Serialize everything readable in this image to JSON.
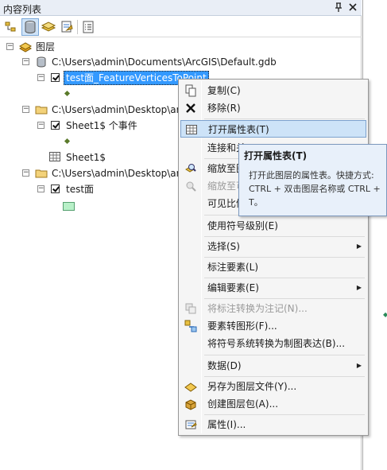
{
  "panel": {
    "title": "内容列表",
    "pin_glyph": "ᵖ",
    "close_glyph": "×"
  },
  "toolbar": {
    "buttons": [
      {
        "icon": "list-by-drawing-order-icon",
        "active": false
      },
      {
        "icon": "list-by-source-icon",
        "active": true
      },
      {
        "icon": "list-by-visibility-icon",
        "active": false
      },
      {
        "icon": "list-by-selection-icon",
        "active": false
      },
      {
        "icon": "options-icon",
        "active": false
      }
    ]
  },
  "tree": {
    "root": "图层",
    "groups": [
      {
        "path": "C:\\Users\\admin\\Documents\\ArcGIS\\Default.gdb",
        "layer": "test面_FeatureVerticesToPoint"
      },
      {
        "path": "C:\\Users\\admin\\Desktop\\ar",
        "layer": "Sheet1$ 个事件",
        "table": "Sheet1$"
      },
      {
        "path": "C:\\Users\\admin\\Desktop\\ar",
        "layer": "test面"
      }
    ]
  },
  "menu": {
    "items": [
      {
        "label": "复制(C)",
        "icon": "copy-icon",
        "disabled": false
      },
      {
        "label": "移除(R)",
        "icon": "remove-icon",
        "disabled": false
      },
      {
        "label": "打开属性表(T)",
        "icon": "table-icon",
        "disabled": false,
        "highlighted": true
      },
      {
        "label": "连接和关",
        "icon": "",
        "disabled": false
      },
      {
        "label": "缩放至图",
        "icon": "zoom-to-layer-icon",
        "disabled": false
      },
      {
        "label": "缩放至可",
        "icon": "zoom-to-visible-icon",
        "disabled": true
      },
      {
        "label": "可见比例",
        "icon": "",
        "disabled": false
      },
      {
        "label": "使用符号级别(E)",
        "icon": "",
        "disabled": false
      },
      {
        "label": "选择(S)",
        "icon": "",
        "disabled": false,
        "submenu": true
      },
      {
        "label": "标注要素(L)",
        "icon": "",
        "disabled": false
      },
      {
        "label": "编辑要素(E)",
        "icon": "",
        "disabled": false,
        "submenu": true
      },
      {
        "label": "将标注转换为注记(N)...",
        "icon": "convert-labels-icon",
        "disabled": true
      },
      {
        "label": "要素转图形(F)...",
        "icon": "features-to-graphics-icon",
        "disabled": false
      },
      {
        "label": "将符号系统转换为制图表达(B)...",
        "icon": "",
        "disabled": false
      },
      {
        "label": "数据(D)",
        "icon": "",
        "disabled": false,
        "submenu": true
      },
      {
        "label": "另存为图层文件(Y)...",
        "icon": "layer-file-icon",
        "disabled": false
      },
      {
        "label": "创建图层包(A)...",
        "icon": "layer-package-icon",
        "disabled": false
      },
      {
        "label": "属性(I)...",
        "icon": "properties-icon",
        "disabled": false
      }
    ],
    "submenu_arrow": "▶"
  },
  "tooltip": {
    "title": "打开属性表(T)",
    "lines": [
      "打开此图层的属性表。快捷方式:",
      "CTRL + 双击图层名称或 CTRL +",
      "T。"
    ]
  },
  "colors": {
    "selection": "#3399ff",
    "menu_highlight": "#cde3f8",
    "tooltip_bg": "#e8f0fa"
  }
}
